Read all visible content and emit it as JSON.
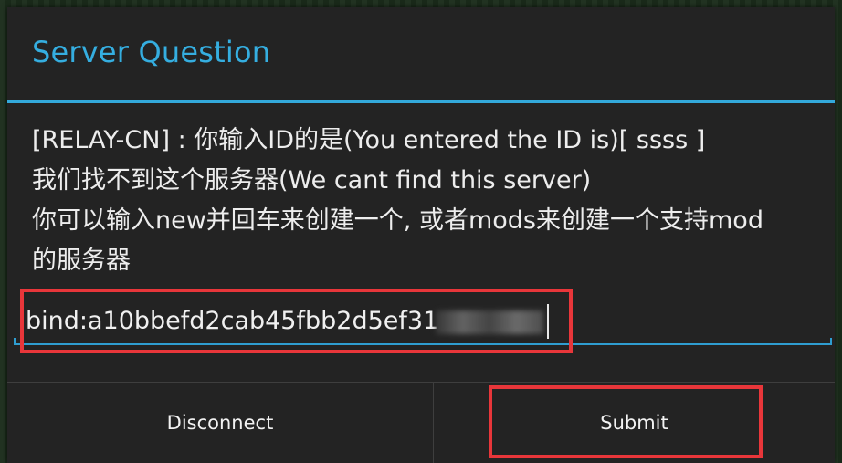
{
  "dialog": {
    "title": "Server Question",
    "message_lines": [
      "[RELAY-CN] : 你输入ID的是(You entered the ID is)[ ssss ]",
      "我们找不到这个服务器(We cant find this server)",
      "你可以输入new并回车来创建一个, 或者mods来创建一个支持mod",
      "的服务器"
    ],
    "input": {
      "value": "bind:a10bbefd2cab45fbb2d5ef31"
    },
    "buttons": {
      "disconnect": "Disconnect",
      "submit": "Submit"
    }
  },
  "colors": {
    "title": "#35aee0",
    "accent_line": "#33a9db",
    "dialog_bg": "#232323",
    "highlight": "#e8363a"
  }
}
